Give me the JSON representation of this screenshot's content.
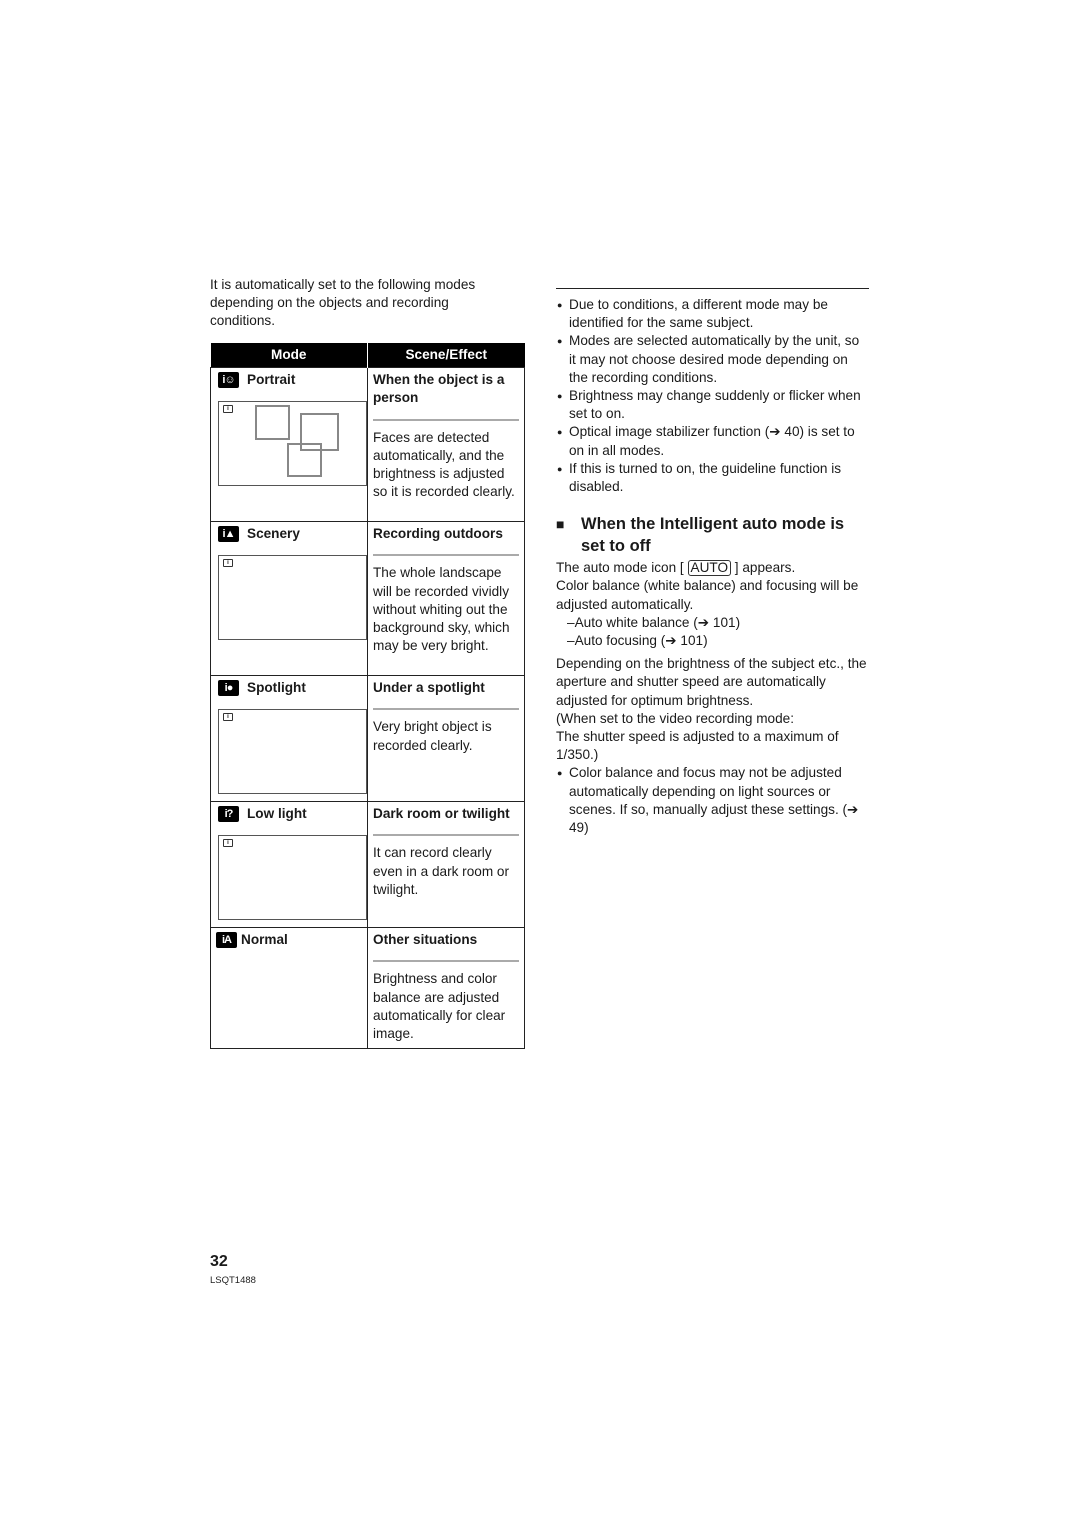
{
  "intro": "It is automatically set to the following modes depending on the objects and recording conditions.",
  "table": {
    "headers": [
      "Mode",
      "Scene/Effect"
    ],
    "rows": [
      {
        "icon": "portrait-mode-icon",
        "icon_text": "i",
        "mode": "Portrait",
        "scene": "When the object is a person",
        "effect": "Faces are detected automatically, and the brightness is adjusted so it is recorded clearly.",
        "has_thumbnail": true,
        "face_boxes": 3
      },
      {
        "icon": "scenery-mode-icon",
        "icon_text": "i",
        "mode": "Scenery",
        "scene": "Recording outdoors",
        "effect": "The whole landscape will be recorded vividly without whiting out the background sky, which may be very bright.",
        "has_thumbnail": true
      },
      {
        "icon": "spotlight-mode-icon",
        "icon_text": "i",
        "mode": "Spotlight",
        "scene": "Under a spotlight",
        "effect": "Very bright object is recorded clearly.",
        "has_thumbnail": true
      },
      {
        "icon": "low-light-mode-icon",
        "icon_text": "i",
        "mode": "Low light",
        "scene": "Dark room or twilight",
        "effect": "It can record clearly even in a dark room or twilight.",
        "has_thumbnail": true
      },
      {
        "icon": "normal-mode-icon",
        "icon_text": "iA",
        "mode": "Normal",
        "scene": "Other situations",
        "effect": "Brightness and color balance are adjusted automatically for clear image.",
        "has_thumbnail": false
      }
    ]
  },
  "notes": [
    "Due to conditions, a different mode may be identified for the same subject.",
    "Modes are selected automatically by the unit, so it may not choose desired mode depending on the recording conditions.",
    "Brightness may change suddenly or flicker when set to on.",
    "Optical image stabilizer function (➔ 40) is set to on in all modes.",
    "If this is turned to on, the guideline function is disabled."
  ],
  "section": {
    "title": "When the Intelligent auto mode is set to off",
    "auto_line_before": "The auto mode icon [",
    "auto_icon": "AUTO",
    "auto_line_after": "] appears.",
    "para1": "Color balance (white balance) and focusing will be adjusted automatically.",
    "dash_items": [
      "Auto white balance (➔ 101)",
      "Auto focusing (➔ 101)"
    ],
    "para2": "Depending on the brightness of the subject etc., the aperture and shutter speed are automatically adjusted for optimum brightness.",
    "para3": "(When set to the video recording mode:",
    "para4": "The shutter speed is adjusted to a maximum of 1/350.)",
    "note": "Color balance and focus may not be adjusted automatically depending on light sources or scenes. If so, manually adjust these settings. (➔ 49)"
  },
  "footer": {
    "page_number": "32",
    "doc_code": "LSQT1488"
  }
}
